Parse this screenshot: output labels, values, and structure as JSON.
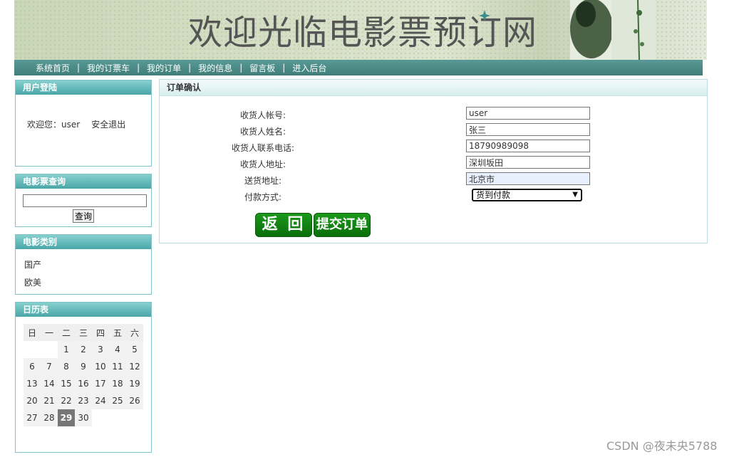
{
  "banner": {
    "title": "欢迎光临电影票预订网"
  },
  "nav": {
    "items": [
      "系统首页",
      "我的订票车",
      "我的订单",
      "我的信息",
      "留言板",
      "进入后台"
    ],
    "separator": "|"
  },
  "login_box": {
    "title": "用户登陆",
    "welcome_text": "欢迎您：user",
    "logout": "安全退出"
  },
  "search_box": {
    "title": "电影票查询",
    "input_value": "",
    "button": "查询"
  },
  "category_box": {
    "title": "电影类别",
    "items": [
      "国产",
      "欧美"
    ]
  },
  "calendar": {
    "title": "日历表",
    "weekdays": [
      "日",
      "一",
      "二",
      "三",
      "四",
      "五",
      "六"
    ],
    "weeks": [
      [
        "",
        "",
        "1",
        "2",
        "3",
        "4",
        "5"
      ],
      [
        "6",
        "7",
        "8",
        "9",
        "10",
        "11",
        "12"
      ],
      [
        "13",
        "14",
        "15",
        "16",
        "17",
        "18",
        "19"
      ],
      [
        "20",
        "21",
        "22",
        "23",
        "24",
        "25",
        "26"
      ],
      [
        "27",
        "28",
        "29",
        "30",
        "",
        "",
        ""
      ]
    ],
    "today": "29"
  },
  "order": {
    "title": "订单确认",
    "fields": [
      {
        "label": "收货人帐号:",
        "value": "user"
      },
      {
        "label": "收货人姓名:",
        "value": "张三"
      },
      {
        "label": "收货人联系电话:",
        "value": "18790989098"
      },
      {
        "label": "收货人地址:",
        "value": "深圳坂田"
      },
      {
        "label": "送货地址:",
        "value": "北京市"
      }
    ],
    "payment_label": "付款方式:",
    "payment_selected": "货到付款",
    "back_button": "返 回",
    "submit_button": "提交订单"
  },
  "watermark": "CSDN @夜未央5788"
}
